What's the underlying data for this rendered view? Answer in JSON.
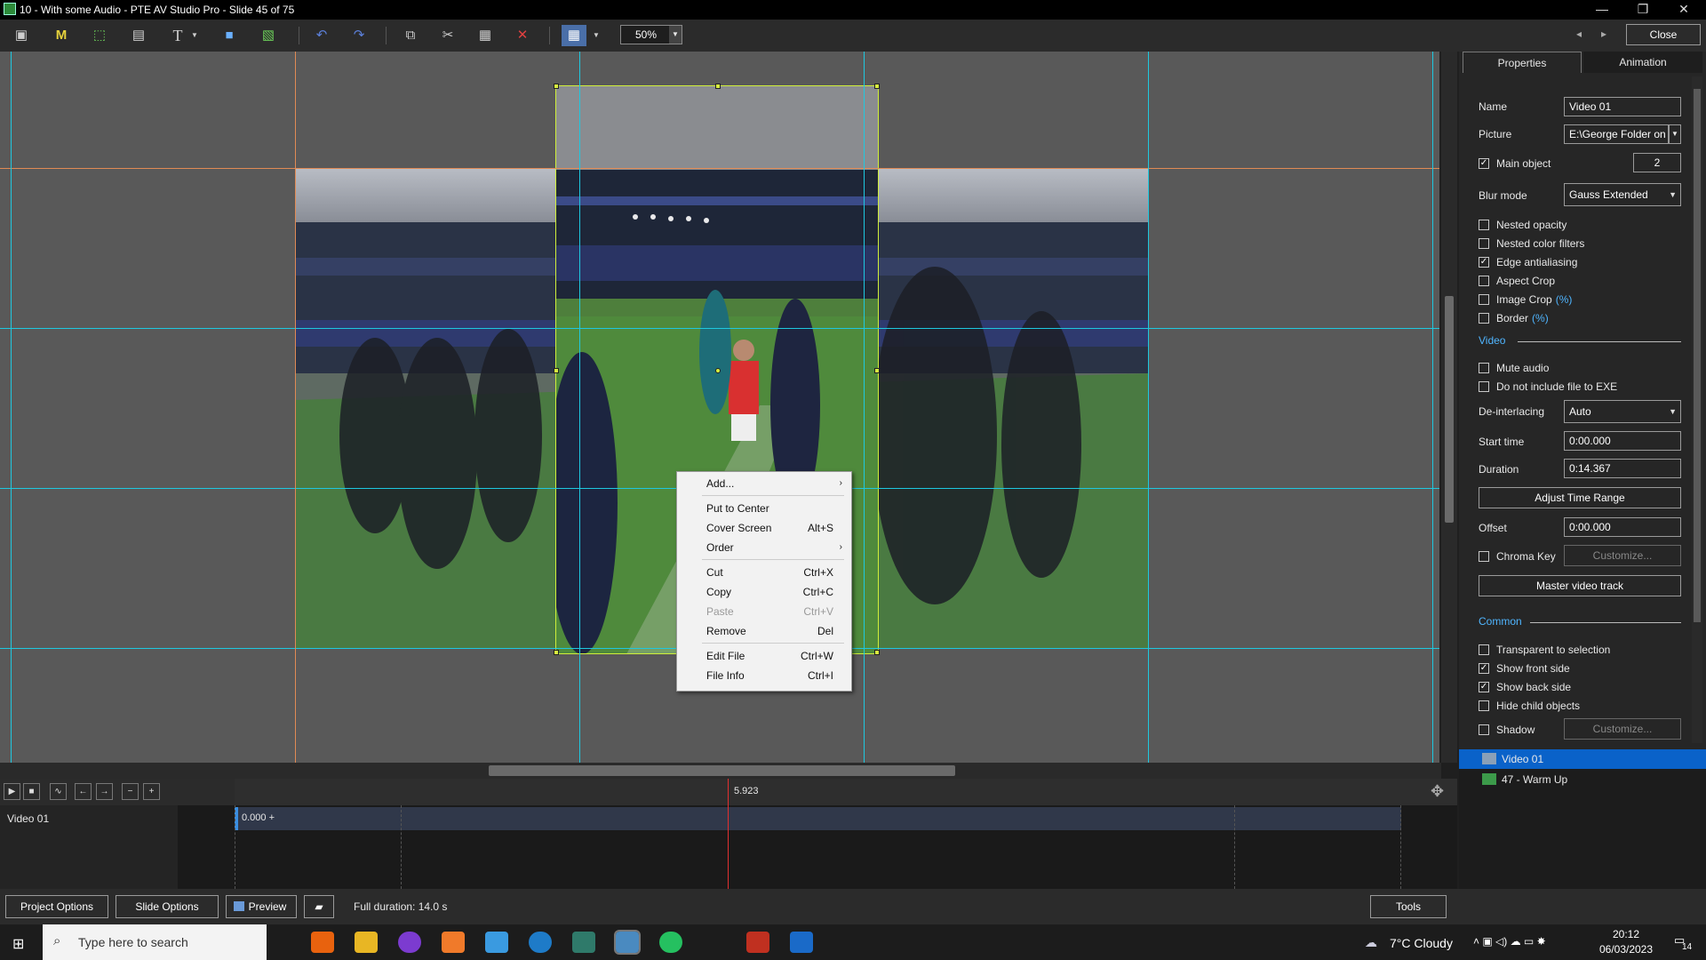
{
  "window": {
    "title": "10 - With some Audio - PTE AV Studio Pro - Slide 45 of 75",
    "minimize": "—",
    "restore": "❐",
    "close_x": "✕"
  },
  "header_right": {
    "close_label": "Close",
    "prev": "◂",
    "next": "▸"
  },
  "toolbar": {
    "zoom": "50%"
  },
  "properties": {
    "tabs": [
      "Properties",
      "Animation"
    ],
    "name_label": "Name",
    "name_value": "Video 01",
    "picture_label": "Picture",
    "picture_value": "E:\\George Folder on",
    "main_object_label": "Main object",
    "main_object_value": "2",
    "blur_mode_label": "Blur mode",
    "blur_mode_value": "Gauss Extended",
    "checks1": [
      {
        "label": "Nested opacity",
        "checked": false
      },
      {
        "label": "Nested color filters",
        "checked": false
      },
      {
        "label": "Edge antialiasing",
        "checked": true
      },
      {
        "label": "Aspect Crop",
        "checked": false
      },
      {
        "label": "Image Crop",
        "checked": false,
        "suffix": "(%)"
      },
      {
        "label": "Border",
        "checked": false,
        "suffix": "(%)"
      }
    ],
    "video_section": "Video",
    "mute_audio": "Mute audio",
    "no_exe": "Do not include file to EXE",
    "deinterlacing_label": "De-interlacing",
    "deinterlacing_value": "Auto",
    "start_time_label": "Start time",
    "start_time_value": "0:00.000",
    "duration_label": "Duration",
    "duration_value": "0:14.367",
    "adjust_time_range": "Adjust Time Range",
    "offset_label": "Offset",
    "offset_value": "0:00.000",
    "chroma_key": "Chroma Key",
    "customize": "Customize...",
    "master_video_track": "Master video track",
    "common_section": "Common",
    "checks2": [
      {
        "label": "Transparent to selection",
        "checked": false
      },
      {
        "label": "Show front side",
        "checked": true
      },
      {
        "label": "Show back side",
        "checked": true
      },
      {
        "label": "Hide child objects",
        "checked": false
      }
    ],
    "shadow": "Shadow",
    "customize2": "Customize..."
  },
  "object_list": [
    {
      "label": "Video 01",
      "selected": true
    },
    {
      "label": "47 - Warm Up",
      "selected": false
    }
  ],
  "context_menu": {
    "add": "Add...",
    "put_to_center": "Put to Center",
    "cover_screen": "Cover Screen",
    "cover_screen_sc": "Alt+S",
    "order": "Order",
    "cut": "Cut",
    "cut_sc": "Ctrl+X",
    "copy": "Copy",
    "copy_sc": "Ctrl+C",
    "paste": "Paste",
    "paste_sc": "Ctrl+V",
    "remove": "Remove",
    "remove_sc": "Del",
    "edit_file": "Edit File",
    "edit_file_sc": "Ctrl+W",
    "file_info": "File Info",
    "file_info_sc": "Ctrl+I"
  },
  "timeline": {
    "track_name": "Video 01",
    "marker_time": "5.923",
    "clip_start": "0.000 +"
  },
  "bottom": {
    "project_options": "Project Options",
    "slide_options": "Slide Options",
    "preview": "Preview",
    "full_duration": "Full duration: 14.0 s",
    "tools": "Tools"
  },
  "taskbar": {
    "search_placeholder": "Type here to search",
    "weather": "7°C  Cloudy",
    "time": "20:12",
    "date": "06/03/2023",
    "notif_count": "14"
  }
}
